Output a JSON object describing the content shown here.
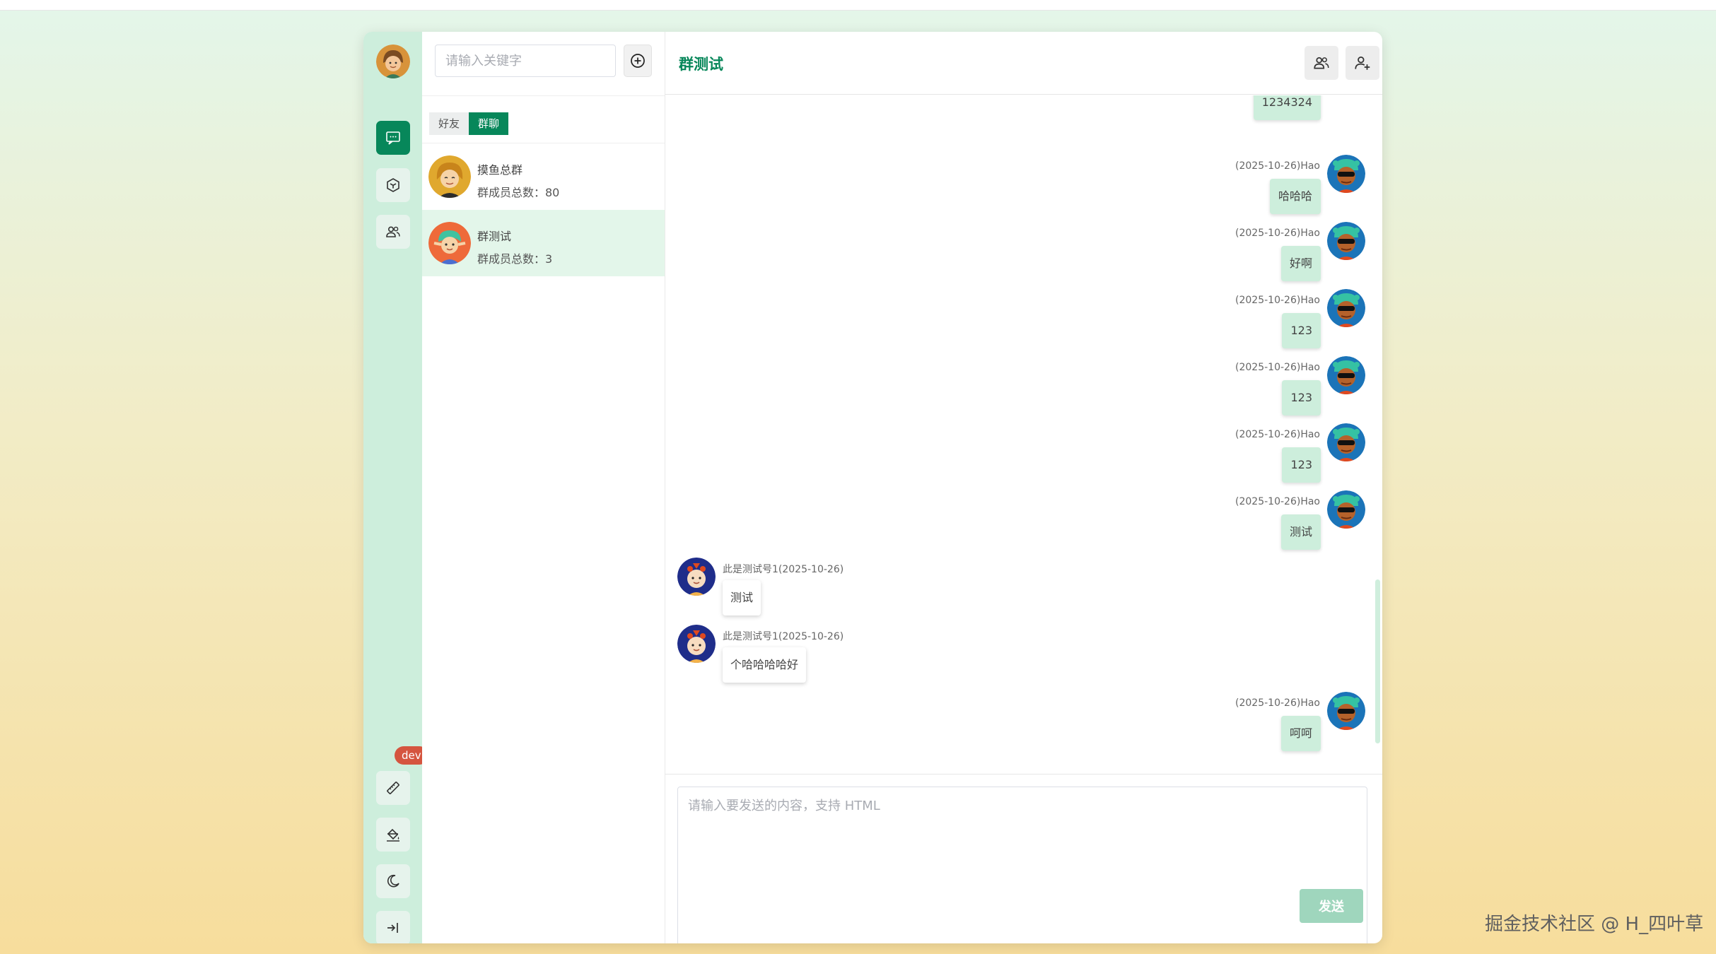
{
  "nav": {
    "dev_badge": "dev"
  },
  "list": {
    "search_placeholder": "请输入关键字",
    "tabs": [
      "好友",
      "群聊"
    ],
    "active_tab": 1,
    "conversations": [
      {
        "name": "摸鱼总群",
        "count": "群成员总数：80"
      },
      {
        "name": "群测试",
        "count": "群成员总数：3"
      }
    ]
  },
  "chat": {
    "title": "群测试",
    "messages": [
      {
        "side": "right",
        "time": "",
        "text": "1234324"
      },
      {
        "side": "right",
        "time": "(2025-10-26)Hao",
        "text": "哈哈哈"
      },
      {
        "side": "right",
        "time": "(2025-10-26)Hao",
        "text": "好啊"
      },
      {
        "side": "right",
        "time": "(2025-10-26)Hao",
        "text": "123"
      },
      {
        "side": "right",
        "time": "(2025-10-26)Hao",
        "text": "123"
      },
      {
        "side": "right",
        "time": "(2025-10-26)Hao",
        "text": "123"
      },
      {
        "side": "right",
        "time": "(2025-10-26)Hao",
        "text": "测试"
      },
      {
        "side": "left",
        "time": "此是测试号1(2025-10-26)",
        "text": "测试"
      },
      {
        "side": "left",
        "time": "此是测试号1(2025-10-26)",
        "text": "个哈哈哈哈好"
      },
      {
        "side": "right",
        "time": "(2025-10-26)Hao",
        "text": "呵呵"
      }
    ],
    "composer_placeholder": "请输入要发送的内容，支持 HTML",
    "send_label": "发送"
  },
  "watermark": "掘金技术社区 @ H_四叶草"
}
